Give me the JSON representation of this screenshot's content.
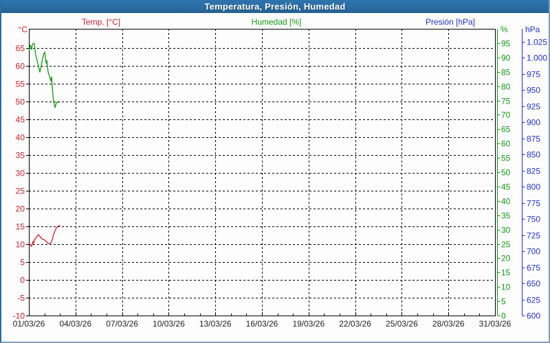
{
  "window": {
    "title": "Temperatura, Presión, Humedad"
  },
  "legend": {
    "temp": "Temp. [°C]",
    "humidity": "Humedad [%]",
    "pressure": "Presión [hPa]"
  },
  "axis_units": {
    "temp": "°C",
    "humidity": "%",
    "pressure": "hPa"
  },
  "colors": {
    "titlebar": "#2a6da3",
    "temp": "#c9202c",
    "humidity": "#149914",
    "pressure": "#2330cc",
    "grid": "#000000",
    "x_labels": "#222222",
    "background": "#fcfdfc"
  },
  "chart_data": {
    "type": "line",
    "title": "Temperatura, Presión, Humedad",
    "x_axis": {
      "labels": [
        "01/03/26",
        "04/03/26",
        "07/03/26",
        "10/03/26",
        "13/03/26",
        "16/03/26",
        "19/03/26",
        "22/03/26",
        "25/03/26",
        "28/03/26",
        "31/03/26"
      ],
      "range_days": [
        0,
        30
      ],
      "major_tick_every_days": 3,
      "minor_tick_every_days": 1,
      "grid": "vertical-dashed"
    },
    "y_axes": {
      "temp": {
        "side": "left",
        "ticks": [
          -10,
          -5,
          0,
          5,
          10,
          15,
          20,
          25,
          30,
          35,
          40,
          45,
          50,
          55,
          60,
          65
        ],
        "range": [
          -10,
          70.4
        ],
        "grid": "horizontal-dashed"
      },
      "humidity": {
        "side": "right-inner",
        "ticks": [
          0,
          5,
          10,
          15,
          20,
          25,
          30,
          35,
          40,
          45,
          50,
          55,
          60,
          65,
          70,
          75,
          80,
          85,
          90,
          95
        ],
        "range": [
          0,
          100
        ]
      },
      "pressure": {
        "side": "right-outer",
        "tick_values": [
          600,
          625,
          650,
          675,
          700,
          725,
          750,
          775,
          800,
          825,
          850,
          875,
          900,
          925,
          950,
          975,
          1000,
          1025
        ],
        "tick_labels": [
          "600",
          "625",
          "650",
          "675",
          "700",
          "725",
          "750",
          "775",
          "800",
          "825",
          "850",
          "875",
          "900",
          "925",
          "950",
          "975",
          "1.000",
          "1.025"
        ],
        "range": [
          600,
          1044.7
        ]
      }
    },
    "series": [
      {
        "name": "Temp. [°C]",
        "axis": "temp",
        "color": "#c9202c",
        "points": [
          [
            0,
            10.2
          ],
          [
            0.09,
            9.8
          ],
          [
            0.18,
            9.4
          ],
          [
            0.22,
            10.0
          ],
          [
            0.27,
            10.8
          ],
          [
            0.31,
            10.2
          ],
          [
            0.35,
            11.2
          ],
          [
            0.44,
            11.7
          ],
          [
            0.53,
            12.3
          ],
          [
            0.62,
            12.7
          ],
          [
            0.66,
            12.5
          ],
          [
            0.75,
            11.9
          ],
          [
            0.84,
            11.5
          ],
          [
            0.93,
            11.3
          ],
          [
            1.02,
            11.2
          ],
          [
            1.11,
            10.8
          ],
          [
            1.19,
            10.4
          ],
          [
            1.28,
            10.2
          ],
          [
            1.37,
            10.2
          ],
          [
            1.42,
            10.4
          ],
          [
            1.5,
            11.2
          ],
          [
            1.59,
            12.7
          ],
          [
            1.68,
            13.8
          ],
          [
            1.77,
            14.6
          ],
          [
            1.86,
            15.0
          ],
          [
            1.99,
            15.2
          ]
        ]
      },
      {
        "name": "Humedad [%]",
        "axis": "humidity",
        "color": "#149914",
        "points": [
          [
            0,
            92.6
          ],
          [
            0.09,
            94.3
          ],
          [
            0.13,
            93.8
          ],
          [
            0.18,
            92.8
          ],
          [
            0.22,
            94.5
          ],
          [
            0.31,
            95.0
          ],
          [
            0.35,
            94.7
          ],
          [
            0.44,
            90.9
          ],
          [
            0.53,
            89.0
          ],
          [
            0.62,
            86.8
          ],
          [
            0.71,
            84.9
          ],
          [
            0.8,
            87.3
          ],
          [
            0.88,
            89.7
          ],
          [
            0.97,
            91.4
          ],
          [
            1.02,
            91.9
          ],
          [
            1.06,
            90.2
          ],
          [
            1.11,
            88.0
          ],
          [
            1.15,
            89.0
          ],
          [
            1.19,
            87.3
          ],
          [
            1.24,
            84.9
          ],
          [
            1.33,
            83.3
          ],
          [
            1.42,
            81.8
          ],
          [
            1.46,
            83.3
          ],
          [
            1.5,
            80.1
          ],
          [
            1.55,
            77.0
          ],
          [
            1.59,
            74.6
          ],
          [
            1.64,
            73.7
          ],
          [
            1.68,
            72.5
          ],
          [
            1.77,
            74.2
          ],
          [
            1.86,
            74.6
          ],
          [
            1.9,
            74.2
          ]
        ]
      },
      {
        "name": "Presión [hPa]",
        "axis": "pressure",
        "color": "#2330cc",
        "points": []
      }
    ]
  }
}
